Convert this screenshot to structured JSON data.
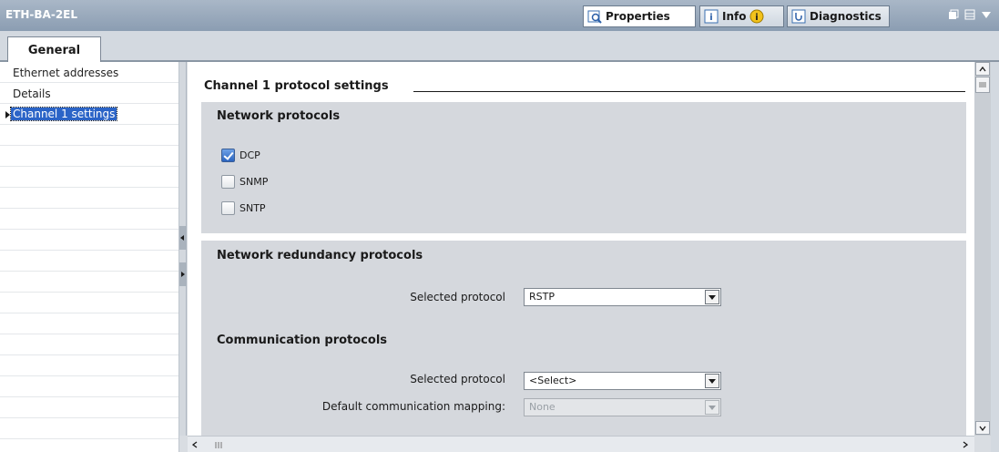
{
  "window": {
    "title": "ETH-BA-2EL",
    "tabs": [
      {
        "label": "Properties",
        "icon": "properties-icon",
        "active": true
      },
      {
        "label": "Info",
        "icon": "info-icon",
        "active": false
      },
      {
        "label": "Diagnostics",
        "icon": "diagnostics-icon",
        "active": false
      }
    ]
  },
  "tabstrip": {
    "general_label": "General"
  },
  "nav": {
    "items": [
      {
        "label": "Ethernet addresses",
        "selected": false
      },
      {
        "label": "Details",
        "selected": false
      },
      {
        "label": "Channel 1 settings",
        "selected": true
      }
    ]
  },
  "main": {
    "section_title": "Channel 1 protocol settings",
    "network_protocols": {
      "heading": "Network protocols",
      "items": [
        {
          "label": "DCP",
          "checked": true
        },
        {
          "label": "SNMP",
          "checked": false
        },
        {
          "label": "SNTP",
          "checked": false
        }
      ]
    },
    "redundancy": {
      "heading": "Network redundancy protocols",
      "selected_label": "Selected protocol",
      "selected_value": "RSTP"
    },
    "communication": {
      "heading": "Communication protocols",
      "selected_label": "Selected protocol",
      "selected_value": "<Select>",
      "mapping_label": "Default communication mapping:",
      "mapping_value": "None"
    }
  },
  "colors": {
    "selection": "#2b64c7",
    "titlebar": "#8b9db2",
    "panel": "#d5d8dd"
  }
}
